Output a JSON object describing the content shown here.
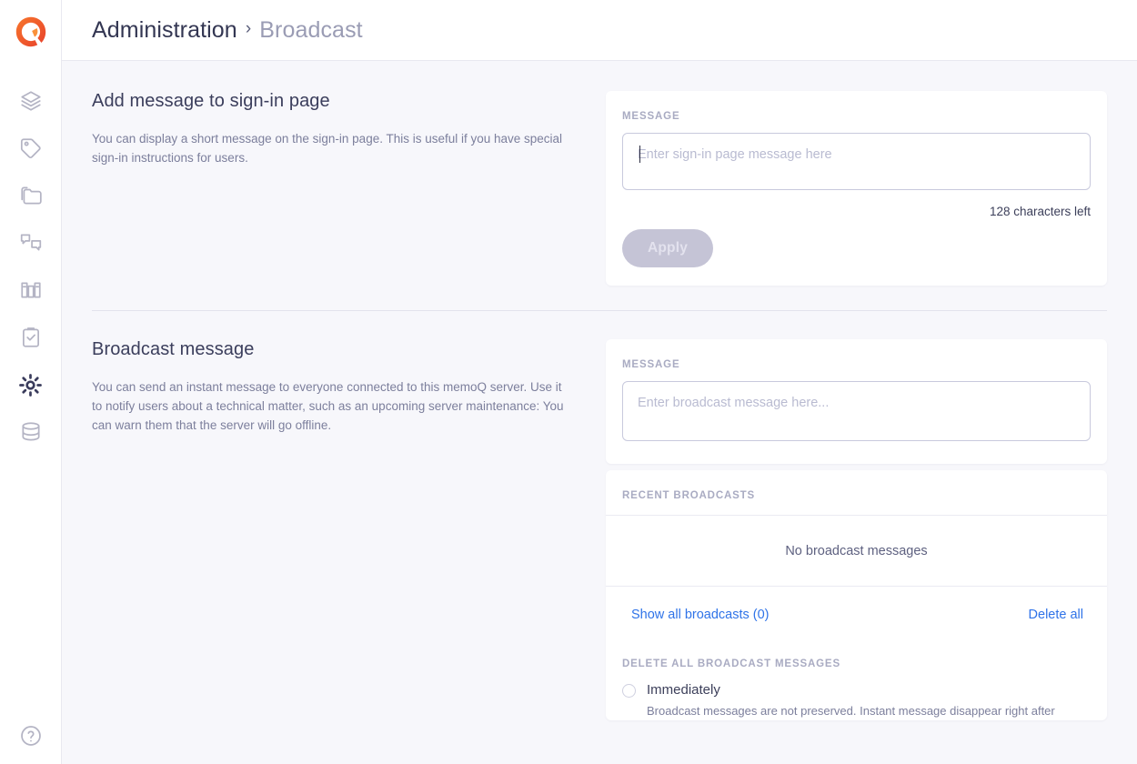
{
  "app": {
    "logo_name": "memoq-logo"
  },
  "sidebar": {
    "items": [
      {
        "icon": "layers-icon",
        "name": "sidebar-item-resources",
        "active": false
      },
      {
        "icon": "tag-icon",
        "name": "sidebar-item-tags",
        "active": false
      },
      {
        "icon": "folders-icon",
        "name": "sidebar-item-projects",
        "active": false
      },
      {
        "icon": "chat-bubbles-icon",
        "name": "sidebar-item-communication",
        "active": false
      },
      {
        "icon": "library-books-icon",
        "name": "sidebar-item-library",
        "active": false
      },
      {
        "icon": "clipboard-check-icon",
        "name": "sidebar-item-tasks",
        "active": false
      },
      {
        "icon": "gear-icon",
        "name": "sidebar-item-administration",
        "active": true
      },
      {
        "icon": "database-icon",
        "name": "sidebar-item-storage",
        "active": false
      }
    ],
    "help_icon": "help-circle-icon"
  },
  "header": {
    "breadcrumb_root": "Administration",
    "breadcrumb_separator": "›",
    "breadcrumb_leaf": "Broadcast"
  },
  "signin_section": {
    "title": "Add message to sign-in page",
    "description": "You can display a short message on the sign-in page. This is useful if you have special sign-in instructions for users.",
    "message_label": "MESSAGE",
    "message_value": "",
    "message_placeholder": "Enter sign-in page message here",
    "char_count": "128 characters left",
    "apply_label": "Apply",
    "apply_disabled": true
  },
  "broadcast_section": {
    "title": "Broadcast message",
    "description": "You can send an instant message to everyone connected to this memoQ server. Use it to notify users about a technical matter, such as an upcoming server maintenance: You can warn them that the server will go offline.",
    "message_label": "MESSAGE",
    "message_value": "",
    "message_placeholder": "Enter broadcast message here...",
    "recent_label": "RECENT BROADCASTS",
    "empty_text": "No broadcast messages",
    "show_all_label": "Show all broadcasts (0)",
    "delete_all_label": "Delete all",
    "delete_section_label": "DELETE ALL BROADCAST MESSAGES",
    "radio_options": [
      {
        "label": "Immediately",
        "description": "Broadcast messages are not preserved. Instant message disappear right after",
        "selected": false
      }
    ]
  },
  "colors": {
    "page_bg": "#f7f7fb",
    "card_bg": "#ffffff",
    "accent_link": "#2f73e8",
    "logo_orange": "#f05a28",
    "text_primary": "#3c3f5a",
    "text_muted": "#7c7f9c",
    "label_muted": "#a9abc2",
    "active_nav": "#3a3c5c"
  }
}
